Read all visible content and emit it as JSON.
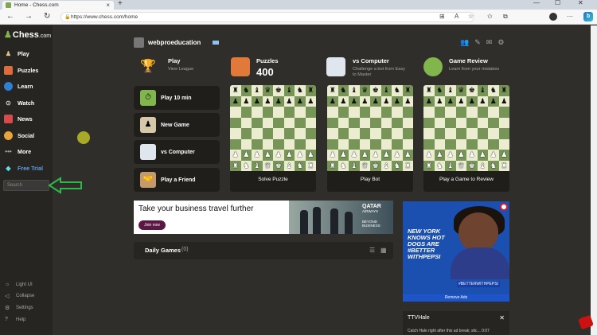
{
  "browser": {
    "tab_title": "Home - Chess.com",
    "new_tab": "+",
    "url": "https://www.chess.com/home",
    "bing": "b",
    "win_min": "—",
    "win_max": "☐",
    "win_close": "✕",
    "back": "←",
    "forward": "→",
    "reload": "↻",
    "lock": "🔒",
    "ic_read": "⊞",
    "ic_aa": "A",
    "ic_star": "☆",
    "ic_fav": "✩",
    "ic_col": "⧉",
    "ic_more": "⋯"
  },
  "sidebar": {
    "logo_main": "Chess",
    "logo_com": ".com",
    "items": [
      {
        "label": "Play",
        "icon": "play-icon"
      },
      {
        "label": "Puzzles",
        "icon": "puzzle-icon"
      },
      {
        "label": "Learn",
        "icon": "learn-icon"
      },
      {
        "label": "Watch",
        "icon": "watch-icon"
      },
      {
        "label": "News",
        "icon": "news-icon"
      },
      {
        "label": "Social",
        "icon": "social-icon"
      },
      {
        "label": "More",
        "icon": "more-icon"
      },
      {
        "label": "Free Trial",
        "icon": "diamond-icon"
      }
    ],
    "search_placeholder": "Search",
    "bottom": [
      {
        "label": "Light UI"
      },
      {
        "label": "Collapse"
      },
      {
        "label": "Settings"
      },
      {
        "label": "Help"
      }
    ]
  },
  "header": {
    "username": "webproeducation"
  },
  "quick": [
    {
      "title": "Play",
      "sub": "View League"
    },
    {
      "title": "Puzzles",
      "big": "400"
    },
    {
      "title": "vs Computer",
      "sub": "Challenge a bot from Easy to Master"
    },
    {
      "title": "Game Review",
      "sub": "Learn from your mistakes"
    }
  ],
  "buttons": [
    {
      "label": "Play 10 min"
    },
    {
      "label": "New Game"
    },
    {
      "label": "vs Computer"
    },
    {
      "label": "Play a Friend"
    }
  ],
  "boards": [
    {
      "label": "Solve Puzzle"
    },
    {
      "label": "Play Bot"
    },
    {
      "label": "Play a Game to Review"
    }
  ],
  "ad_banner": {
    "headline": "Take your business travel further",
    "button": "Join now",
    "brand": "QATAR",
    "brand_sub": "AIRWAYS",
    "tagline": "BEYOND BUSINESS"
  },
  "daily": {
    "title": "Daily Games",
    "count": "(0)"
  },
  "side_ad": {
    "headline": "NEW YORK KNOWS HOT DOGS ARE #BETTER WITHPEPSI",
    "hashtag": "#BETTERWITHPEPSI",
    "remove": "Remove Ads"
  },
  "ttv": {
    "title": "TTVHale",
    "sub": "Catch Hale right after this ad break; stic... 0:07"
  },
  "colors": {
    "accent": "#81b64c",
    "trial": "#5d9ee8",
    "bg": "#302e2b",
    "sidebar": "#262522"
  }
}
